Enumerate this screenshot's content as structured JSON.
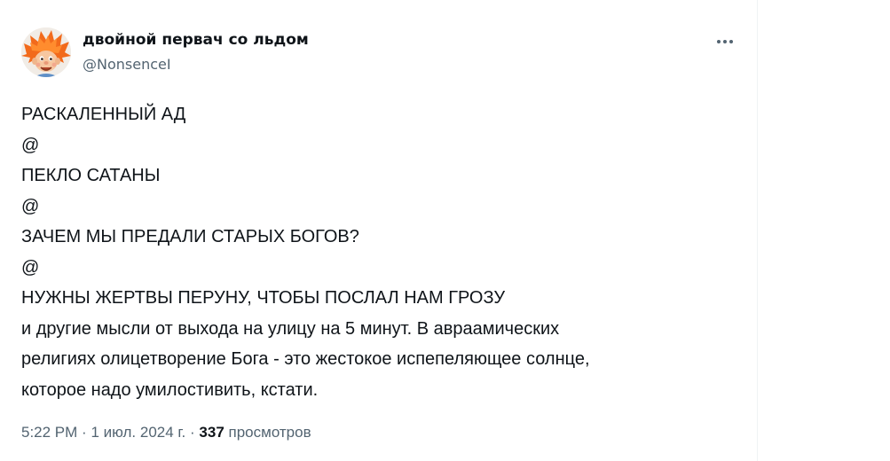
{
  "author": {
    "display_name": "двойной первач со льдом",
    "handle": "@NonsenceI",
    "avatar_icon": "orange-haired-character-avatar"
  },
  "more_icon": "more-horizontal-icon",
  "tweet": {
    "lines": [
      "РАСКАЛЕННЫЙ АД",
      "@",
      "ПЕКЛО САТАНЫ",
      "@",
      "ЗАЧЕМ МЫ ПРЕДАЛИ СТАРЫХ БОГОВ?",
      "@",
      "НУЖНЫ ЖЕРТВЫ ПЕРУНУ, ЧТОБЫ ПОСЛАЛ НАМ ГРОЗУ",
      "и другие мысли от выхода на улицу на 5 минут. В авраамических",
      "религиях олицетворение Бога - это жестокое испепеляющее солнце,",
      "которое надо умилостивить, кстати."
    ]
  },
  "meta": {
    "time": "5:22 PM",
    "separator": "·",
    "date": "1 июл. 2024 г.",
    "views_count": "337",
    "views_label": "просмотров"
  },
  "colors": {
    "text_primary": "#0f1419",
    "text_secondary": "#536471",
    "divider": "#eff3f4"
  }
}
